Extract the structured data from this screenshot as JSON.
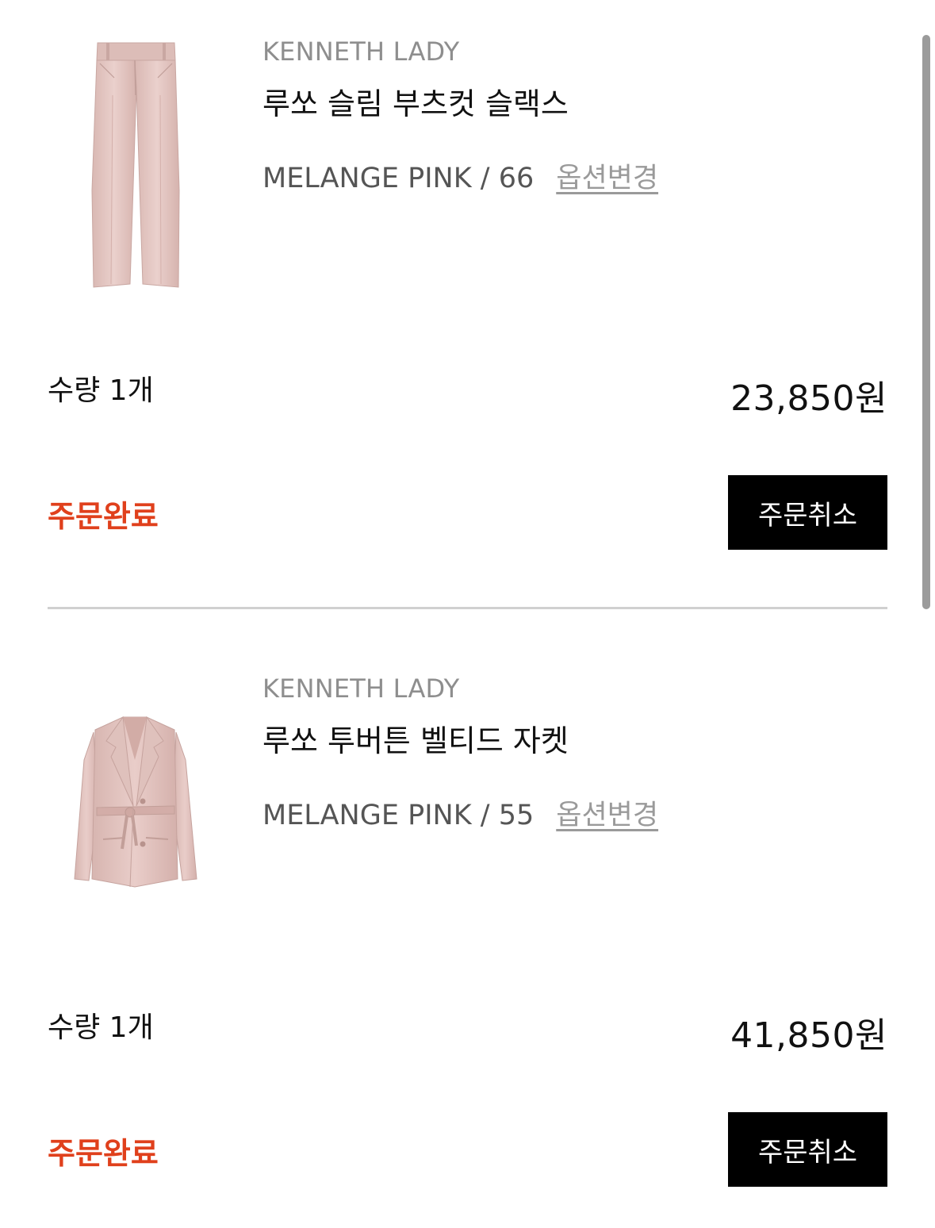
{
  "orders": [
    {
      "brand": "KENNETH LADY",
      "name": "루쏘 슬림 부츠컷 슬랙스",
      "option": "MELANGE PINK / 66",
      "option_change": "옵션변경",
      "quantity": "수량 1개",
      "price": "23,850원",
      "status": "주문완료",
      "cancel": "주문취소",
      "thumbnail_icon": "pants-image"
    },
    {
      "brand": "KENNETH LADY",
      "name": "루쏘 투버튼 벨티드 자켓",
      "option": "MELANGE PINK / 55",
      "option_change": "옵션변경",
      "quantity": "수량 1개",
      "price": "41,850원",
      "status": "주문완료",
      "cancel": "주문취소",
      "thumbnail_icon": "jacket-image"
    }
  ],
  "colors": {
    "status": "#e0401c",
    "button_bg": "#000000",
    "button_text": "#ffffff",
    "product_pink": "#e6c9c5"
  }
}
